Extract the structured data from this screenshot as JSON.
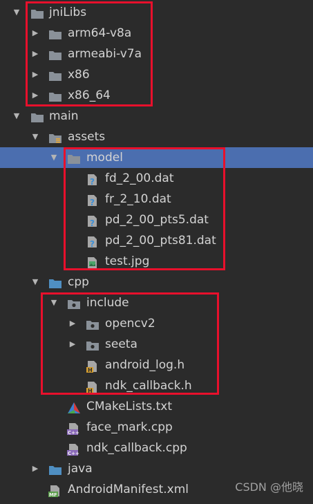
{
  "tree": [
    {
      "label": "jniLibs",
      "depth": 0,
      "arrow": "down",
      "icon": "folder"
    },
    {
      "label": "arm64-v8a",
      "depth": 1,
      "arrow": "right",
      "icon": "folder"
    },
    {
      "label": "armeabi-v7a",
      "depth": 1,
      "arrow": "right",
      "icon": "folder"
    },
    {
      "label": "x86",
      "depth": 1,
      "arrow": "right",
      "icon": "folder"
    },
    {
      "label": "x86_64",
      "depth": 1,
      "arrow": "right",
      "icon": "folder"
    },
    {
      "label": "main",
      "depth": 0,
      "arrow": "down",
      "icon": "folder"
    },
    {
      "label": "assets",
      "depth": 1,
      "arrow": "down",
      "icon": "folder-assets"
    },
    {
      "label": "model",
      "depth": 2,
      "arrow": "down",
      "icon": "folder",
      "selected": true
    },
    {
      "label": "fd_2_00.dat",
      "depth": 3,
      "arrow": "",
      "icon": "unknown-file"
    },
    {
      "label": "fr_2_10.dat",
      "depth": 3,
      "arrow": "",
      "icon": "unknown-file"
    },
    {
      "label": "pd_2_00_pts5.dat",
      "depth": 3,
      "arrow": "",
      "icon": "unknown-file"
    },
    {
      "label": "pd_2_00_pts81.dat",
      "depth": 3,
      "arrow": "",
      "icon": "unknown-file"
    },
    {
      "label": "test.jpg",
      "depth": 3,
      "arrow": "",
      "icon": "image-file"
    },
    {
      "label": "cpp",
      "depth": 1,
      "arrow": "down",
      "icon": "folder-blue"
    },
    {
      "label": "include",
      "depth": 2,
      "arrow": "down",
      "icon": "folder-package"
    },
    {
      "label": "opencv2",
      "depth": 3,
      "arrow": "right",
      "icon": "folder-package"
    },
    {
      "label": "seeta",
      "depth": 3,
      "arrow": "right",
      "icon": "folder-package"
    },
    {
      "label": "android_log.h",
      "depth": 3,
      "arrow": "",
      "icon": "h-file"
    },
    {
      "label": "ndk_callback.h",
      "depth": 3,
      "arrow": "",
      "icon": "h-file"
    },
    {
      "label": "CMakeLists.txt",
      "depth": 2,
      "arrow": "",
      "icon": "cmake-file"
    },
    {
      "label": "face_mark.cpp",
      "depth": 2,
      "arrow": "",
      "icon": "cpp-file"
    },
    {
      "label": "ndk_callback.cpp",
      "depth": 2,
      "arrow": "",
      "icon": "cpp-file"
    },
    {
      "label": "java",
      "depth": 1,
      "arrow": "right",
      "icon": "folder-blue"
    },
    {
      "label": "AndroidManifest.xml",
      "depth": 1,
      "arrow": "",
      "icon": "manifest-file"
    }
  ],
  "watermark": "CSDN @他晓",
  "colors": {
    "background": "#2b2b2b",
    "selection": "#4b6eaf",
    "highlight_box": "#e8102c",
    "folder": "#8a9199",
    "folder_blue": "#4f8fc2",
    "text": "#d3d3d3"
  }
}
